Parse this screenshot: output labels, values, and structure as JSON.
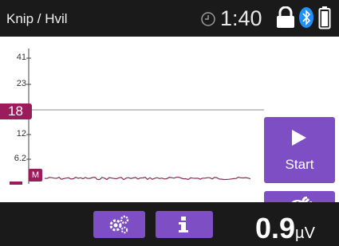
{
  "header": {
    "title": "Knip / Hvil",
    "time": "1:40"
  },
  "plot": {
    "tick_labels": [
      "41",
      "23",
      "12",
      "6.2"
    ],
    "level_value": "18",
    "marker_label": "M"
  },
  "buttons": {
    "start_label": "Start"
  },
  "footer": {
    "reading_value": "0.9",
    "reading_unit": "µV"
  },
  "colors": {
    "accent_purple": "#7e4fc4",
    "marker_crimson": "#9b1c5a",
    "bar_background": "#1a1a1a",
    "bluetooth_blue": "#1e90ff"
  },
  "icons": [
    "clock-icon",
    "lock-icon",
    "bluetooth-icon",
    "battery-icon",
    "play-icon",
    "network-settings-icon",
    "settings-icon",
    "info-icon"
  ]
}
